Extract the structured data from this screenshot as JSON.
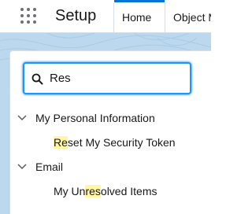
{
  "header": {
    "app_launcher_icon": "app-launcher-icon",
    "app_name": "Setup",
    "tabs": [
      {
        "label": "Home",
        "active": true
      },
      {
        "label": "Object M",
        "active": false
      }
    ]
  },
  "search": {
    "icon": "search-icon",
    "value": "Res"
  },
  "results": {
    "sections": [
      {
        "label": "My Personal Information",
        "icon": "chevron-down-icon",
        "items": [
          {
            "pre": "",
            "match": "Re",
            "post": "set My Security Token"
          }
        ]
      },
      {
        "label": "Email",
        "icon": "chevron-down-icon",
        "items": [
          {
            "pre": "My Un",
            "match": "res",
            "post": "olved Items"
          }
        ]
      }
    ]
  },
  "colors": {
    "accent": "#0176d3",
    "focus_border": "#1b96ff",
    "highlight": "#fff6a6",
    "backdrop": "#bcd8ee"
  }
}
